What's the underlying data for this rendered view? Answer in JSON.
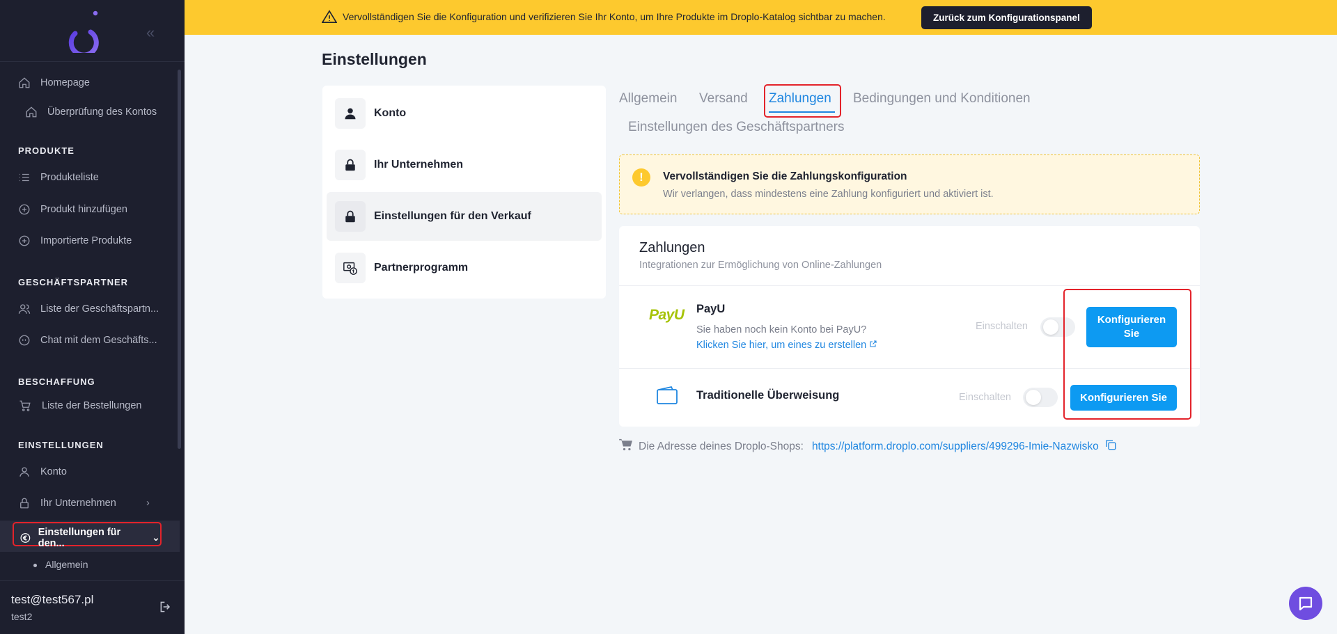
{
  "banner": {
    "text": "Vervollständigen Sie die Konfiguration und verifizieren Sie Ihr Konto, um Ihre Produkte im Droplo-Katalog sichtbar zu machen.",
    "button_label": "Zurück zum Konfigurationspanel"
  },
  "sidebar": {
    "items_top": [
      {
        "label": "Homepage",
        "icon": "home-icon"
      },
      {
        "label": "Überprüfung des Kontos",
        "icon": "home-icon"
      }
    ],
    "sections": [
      {
        "title": "PRODUKTE"
      },
      {
        "title": "GESCHÄFTSPARTNER"
      },
      {
        "title": "BESCHAFFUNG"
      },
      {
        "title": "EINSTELLUNGEN"
      }
    ],
    "products": [
      "Produkteliste",
      "Produkt hinzufügen",
      "Importierte Produkte"
    ],
    "partners": [
      "Liste der Geschäftspartn...",
      "Chat mit dem Geschäfts..."
    ],
    "procurement": [
      "Liste der Bestellungen"
    ],
    "settings": [
      "Konto",
      "Ihr Unternehmen"
    ],
    "active_label": "Einstellungen für den...",
    "sub_item": "Allgemein",
    "user_email": "test@test567.pl",
    "user_name": "test2"
  },
  "page": {
    "title": "Einstellungen"
  },
  "settings_menu": [
    {
      "label": "Konto",
      "icon": "user-icon"
    },
    {
      "label": "Ihr Unternehmen",
      "icon": "lock-icon"
    },
    {
      "label": "Einstellungen für den Verkauf",
      "icon": "lock-icon"
    },
    {
      "label": "Partnerprogramm",
      "icon": "partner-program-icon"
    }
  ],
  "tabs": [
    {
      "label": "Allgemein"
    },
    {
      "label": "Versand"
    },
    {
      "label": "Zahlungen"
    },
    {
      "label": "Bedingungen und Konditionen"
    },
    {
      "label": "Einstellungen des Geschäftspartners"
    }
  ],
  "warning": {
    "title": "Vervollständigen Sie die Zahlungskonfiguration",
    "text": "Wir verlangen, dass mindestens eine Zahlung konfiguriert und aktiviert ist."
  },
  "payments": {
    "title": "Zahlungen",
    "subtitle": "Integrationen zur Ermöglichung von Online-Zahlungen",
    "providers": [
      {
        "name": "PayU",
        "logo_text": "PayU",
        "desc": "Sie haben noch kein Konto bei PayU?",
        "link": "Klicken Sie hier, um eines zu erstellen",
        "switch_label": "Einschalten",
        "button_line1": "Konfigurieren",
        "button_line2": "Sie",
        "enabled": false
      },
      {
        "name": "Traditionelle Überweisung",
        "switch_label": "Einschalten",
        "button": "Konfigurieren Sie",
        "enabled": false
      }
    ]
  },
  "shop": {
    "label": "Die Adresse deines Droplo-Shops:",
    "url": "https://platform.droplo.com/suppliers/499296-Imie-Nazwisko"
  },
  "colors": {
    "accent": "#1f86e0",
    "button": "#0d9af2",
    "banner": "#fdc92e",
    "sidebar": "#1d1f2e",
    "highlight": "#e3232b"
  }
}
